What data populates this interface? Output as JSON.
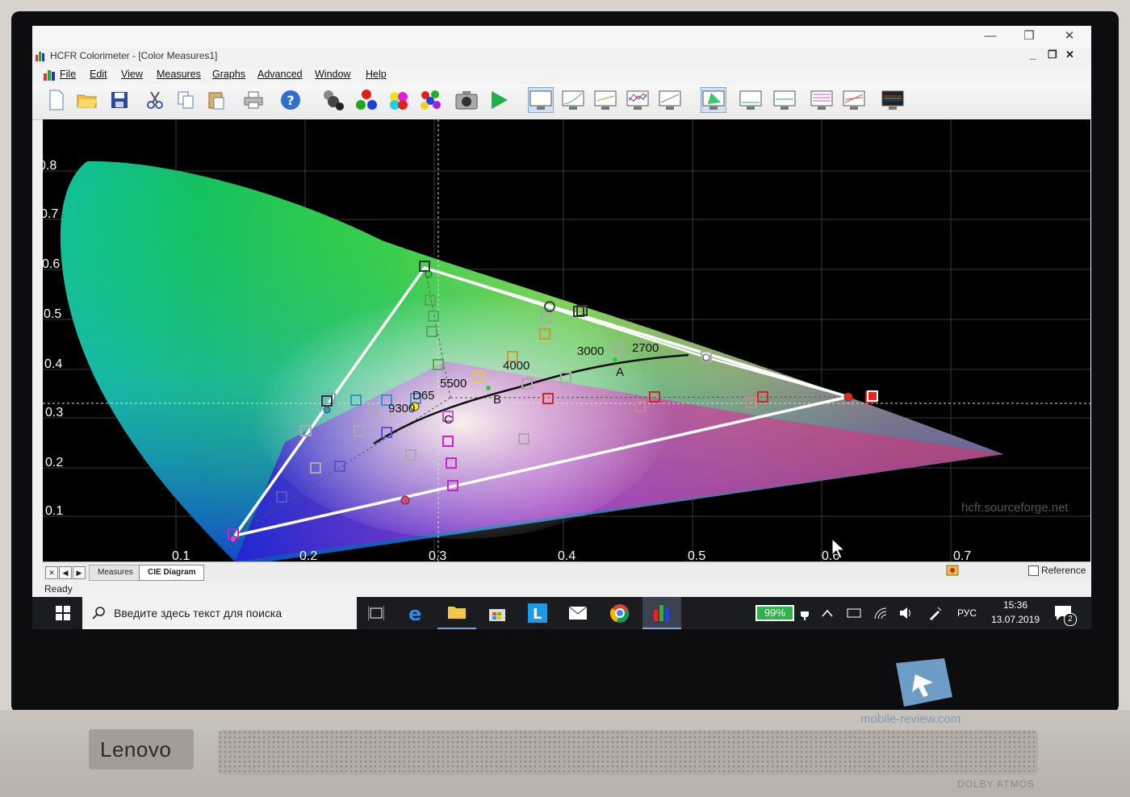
{
  "window": {
    "title": "HCFR Colorimeter - [Color Measures1]",
    "min": "—",
    "max": "❐",
    "close": "✕"
  },
  "mdi": {
    "min": "_",
    "restore": "❐",
    "close": "✕"
  },
  "menu": [
    "File",
    "Edit",
    "View",
    "Measures",
    "Graphs",
    "Advanced",
    "Window",
    "Help"
  ],
  "plot": {
    "x_ticks": [
      "0.1",
      "0.2",
      "0.3",
      "0.4",
      "0.5",
      "0.6",
      "0.7"
    ],
    "y_ticks": [
      "0.8",
      "0.7",
      "0.6",
      "0.5",
      "0.4",
      "0.3",
      "0.2",
      "0.1"
    ],
    "temperature_labels": [
      "2700",
      "3000",
      "4000",
      "5500",
      "6500",
      "9300"
    ],
    "illuminant_labels": [
      "A",
      "B",
      "C",
      "D65"
    ],
    "watermark": "hcfr.sourceforge.net"
  },
  "tabs": {
    "nav": [
      "✕",
      "◀",
      "▶"
    ],
    "items": [
      "Measures",
      "CIE Diagram"
    ],
    "reference_label": "Reference"
  },
  "status": {
    "text": "Ready"
  },
  "taskbar": {
    "search_placeholder": "Введите здесь текст для поиска",
    "battery": "99%",
    "language": "РУС",
    "time": "15:36",
    "date": "13.07.2019",
    "notifications": "2"
  },
  "device": {
    "brand": "Lenovo",
    "audio": "DOLBY ATMOS",
    "photo_watermark": "mobile-review.com"
  },
  "colors": {
    "accent": "#0078d7",
    "battery_green": "#2fb34a",
    "plot_bg": "#000000"
  }
}
